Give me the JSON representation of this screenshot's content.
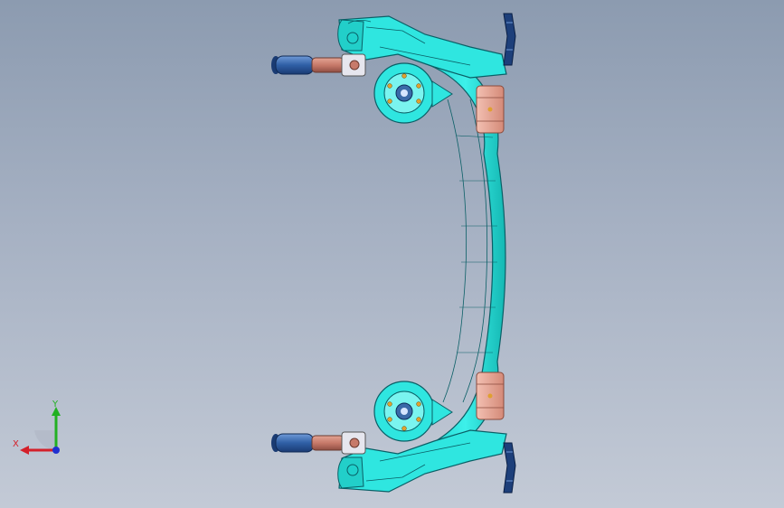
{
  "viewport": {
    "background_top": "#8c9bb0",
    "background_bottom": "#c3cad6"
  },
  "model": {
    "name_hidden": "",
    "main_color": "#2fe6e0",
    "edge_color": "#0a5f66",
    "hub_color": "#7af4ef",
    "shock_color": "#c77a6a",
    "spring_color": "#2f5fa6",
    "bushing_color": "#e8a18e",
    "bracket_color": "#1d3f7a"
  },
  "triad": {
    "x_label": "X",
    "y_label": "Y",
    "x_color": "#d4202a",
    "y_color": "#22b022",
    "z_color": "#2030d0"
  }
}
